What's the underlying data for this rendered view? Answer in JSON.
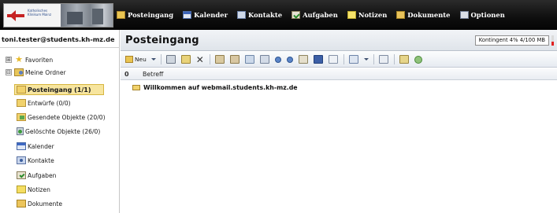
{
  "nav": {
    "logo_text": "Katholisches Klinikum Mainz",
    "items": [
      {
        "label": "Posteingang",
        "icon": "inbox-icon"
      },
      {
        "label": "Kalender",
        "icon": "calendar-icon"
      },
      {
        "label": "Kontakte",
        "icon": "contacts-icon"
      },
      {
        "label": "Aufgaben",
        "icon": "tasks-icon"
      },
      {
        "label": "Notizen",
        "icon": "notes-icon"
      },
      {
        "label": "Dokumente",
        "icon": "documents-icon"
      },
      {
        "label": "Optionen",
        "icon": "options-icon"
      }
    ]
  },
  "sidebar": {
    "user": "toni.tester@students.kh-mz.de",
    "favorites": {
      "label": "Favoriten",
      "expander": "⊞"
    },
    "my_folders": {
      "label": "Meine Ordner",
      "expander": "⊟"
    },
    "folders": [
      {
        "label": "Posteingang (1/1)",
        "icon": "inbox-folder-icon",
        "selected": true
      },
      {
        "label": "Entwürfe (0/0)",
        "icon": "drafts-folder-icon"
      },
      {
        "label": "Gesendete Objekte (20/0)",
        "icon": "sent-folder-icon"
      },
      {
        "label": "Gelöschte Objekte (26/0)",
        "icon": "deleted-items-icon"
      },
      {
        "label": "Kalender",
        "icon": "calendar-icon"
      },
      {
        "label": "Kontakte",
        "icon": "contacts-icon"
      },
      {
        "label": "Aufgaben",
        "icon": "tasks-icon"
      },
      {
        "label": "Notizen",
        "icon": "notes-icon"
      },
      {
        "label": "Dokumente",
        "icon": "documents-icon"
      }
    ]
  },
  "main": {
    "title": "Posteingang",
    "quota": {
      "label": "Kontingent 4% 4/100 MB",
      "percent_used": 4,
      "used_mb": 4,
      "total_mb": 100,
      "indicator_color": "#e02020"
    },
    "toolbar": {
      "new_label": "Neu"
    },
    "columns": {
      "attachment": "0",
      "subject": "Betreff"
    },
    "messages": [
      {
        "subject": "Willkommen auf webmail.students.kh-mz.de",
        "unread": true
      }
    ]
  },
  "colors": {
    "topbar": "#0e0e0e",
    "selection": "#f7e59e",
    "header_gradient_top": "#f2f4f7",
    "header_gradient_bottom": "#dfe4ea"
  }
}
